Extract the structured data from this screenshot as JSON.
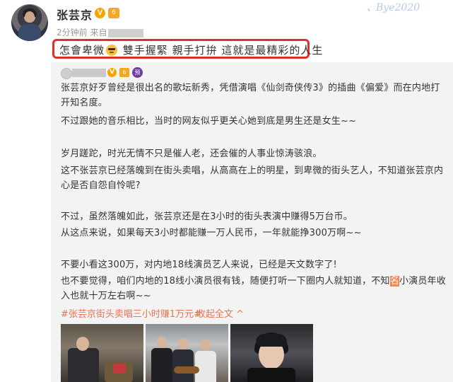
{
  "post": {
    "author": "张芸京",
    "v_badge": "V",
    "rank_badge": "6",
    "time_prefix": "2分钟前 来自",
    "text_part1": "怎會卑微",
    "text_part2": "雙手握緊 親手打拚 這就是最精彩的人生"
  },
  "watermark": {
    "script": "Bye2020",
    "chinese": "、"
  },
  "repost": {
    "badges": [
      "V",
      "6",
      "预"
    ],
    "paragraphs": [
      "张芸京好歹曾经是很出名的歌坛新秀，凭借演唱《仙剑奇侠传3》的插曲《偏爱》而在内地打开知名度。",
      "不过跟她的音乐相比，当时的网友似乎更关心她到底是男生还是女生~~",
      "岁月蹉跎，时光无情不只是催人老，还会催的人事业惊涛骇浪。",
      "这不张芸京已经落魄到在街头卖唱，从高高在上的明星，到卑微的街头艺人，不知道张芸京内心是否自怨自怜呢?",
      "不过，虽然落魄如此，张芸京还是在3小时的街头表演中赚得5万台币。",
      "从这点来说，如果每天3小时都能赚一万人民币，一年就能挣300万啊~~",
      "不要小看这300万，对内地18线演员艺人来说，已经是天文数字了!"
    ],
    "last_para_a": "也不要觉得，咱们内地的18线小演员很有钱，随便打听一下圈内人就知道，不知",
    "last_para_hl": "名",
    "last_para_b": "小演员年收入也就十万左右啊~~",
    "hashtag": "#张芸京街头卖唱三小时赚1万元#",
    "collapse": "收起全文 ^"
  },
  "colors": {
    "highlight_border": "#e0302b",
    "link": "#eb7350",
    "repost_bg": "#f3f3f3",
    "verified": "#f7a300"
  }
}
